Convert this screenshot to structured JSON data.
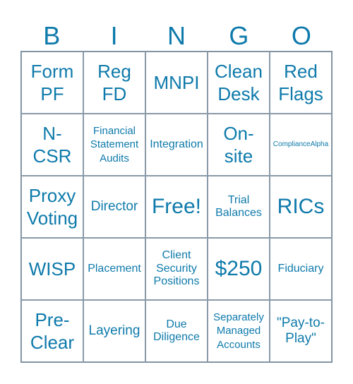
{
  "header": [
    "B",
    "I",
    "N",
    "G",
    "O"
  ],
  "accent_color": "#0e7aab",
  "cells": [
    [
      "Form PF",
      "Reg FD",
      "MNPI",
      "Clean Desk",
      "Red Flags"
    ],
    [
      "N-CSR",
      "Financial Statement Audits",
      "Integration",
      "On-site",
      "ComplianceAlpha"
    ],
    [
      "Proxy Voting",
      "Director",
      "Free!",
      "Trial Balances",
      "RICs"
    ],
    [
      "WISP",
      "Placement",
      "Client Security Positions",
      "$250",
      "Fiduciary"
    ],
    [
      "Pre-Clear",
      "Layering",
      "Due Diligence",
      "Separately Managed Accounts",
      "\"Pay-to-Play\""
    ]
  ]
}
